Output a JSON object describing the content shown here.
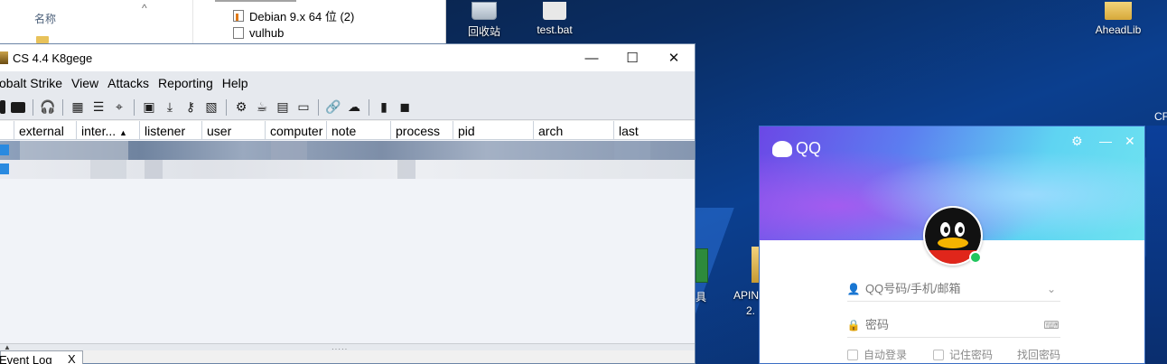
{
  "explorer": {
    "column_name": "名称",
    "items": [
      {
        "label": "Debian 9.x 64 位 (2)"
      },
      {
        "label": "vulhub"
      }
    ]
  },
  "desktop": {
    "icons": [
      {
        "label": "回收站"
      },
      {
        "label": "test.bat"
      },
      {
        "label": "AheadLib"
      },
      {
        "label": "具"
      },
      {
        "label": "APIN"
      },
      {
        "label": "2."
      },
      {
        "label": "CF"
      }
    ]
  },
  "cs": {
    "title": "CS 4.4 K8gege",
    "window_controls": {
      "minimize": "—",
      "maximize": "☐",
      "close": "✕"
    },
    "menu": [
      "obalt Strike",
      "View",
      "Attacks",
      "Reporting",
      "Help"
    ],
    "columns": [
      "external",
      "inter...",
      "listener",
      "user",
      "computer",
      "note",
      "process",
      "pid",
      "arch",
      "last"
    ],
    "sorted_column_indicator": "▲",
    "rows_visible": 2,
    "event_tab": {
      "label": "Event Log",
      "close": "X"
    },
    "splitter_grip": "·····"
  },
  "qq": {
    "brand": "QQ",
    "controls": {
      "settings": "⚙",
      "minimize": "—",
      "close": "✕"
    },
    "account_placeholder": "QQ号码/手机/邮箱",
    "password_placeholder": "密码",
    "options": {
      "auto_login": "自动登录",
      "remember_password": "记住密码",
      "retrieve_password": "找回密码"
    },
    "colors": {
      "banner_start": "#6b48e6",
      "banner_end": "#6fe3f0",
      "online": "#22c55e"
    }
  }
}
